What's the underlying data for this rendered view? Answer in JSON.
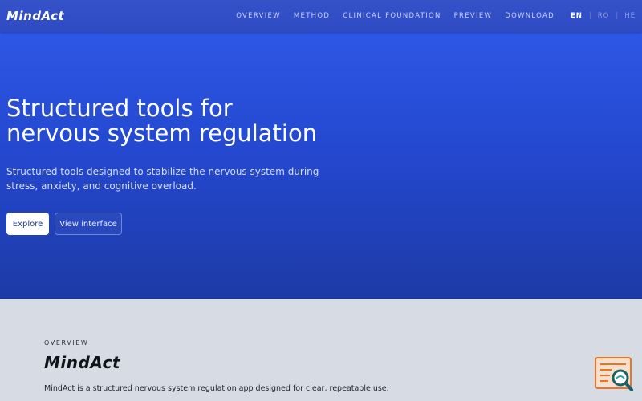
{
  "nav": {
    "logo": "MindAct",
    "links": [
      "OVERVIEW",
      "METHOD",
      "CLINICAL FOUNDATION",
      "PREVIEW",
      "DOWNLOAD"
    ],
    "languages": [
      "EN",
      "RO",
      "HE"
    ],
    "active_language": "EN"
  },
  "hero": {
    "title_line1": "Structured tools for",
    "title_line2": "nervous system regulation",
    "subtitle": "Structured tools designed to stabilize the nervous system during stress, anxiety, and cognitive overload.",
    "primary_button": "Explore",
    "secondary_button": "View interface"
  },
  "overview": {
    "label": "OVERVIEW",
    "logo": "MindAct",
    "text": "MindAct is a structured nervous system regulation app designed for clear, repeatable use."
  },
  "icons": {
    "floating_button": "search-document-icon"
  },
  "colors": {
    "hero_top": "#2d57e6",
    "hero_bottom": "#1d3aa6",
    "overview_bg": "#d7dce4",
    "fab_accent": "#e8742a"
  }
}
